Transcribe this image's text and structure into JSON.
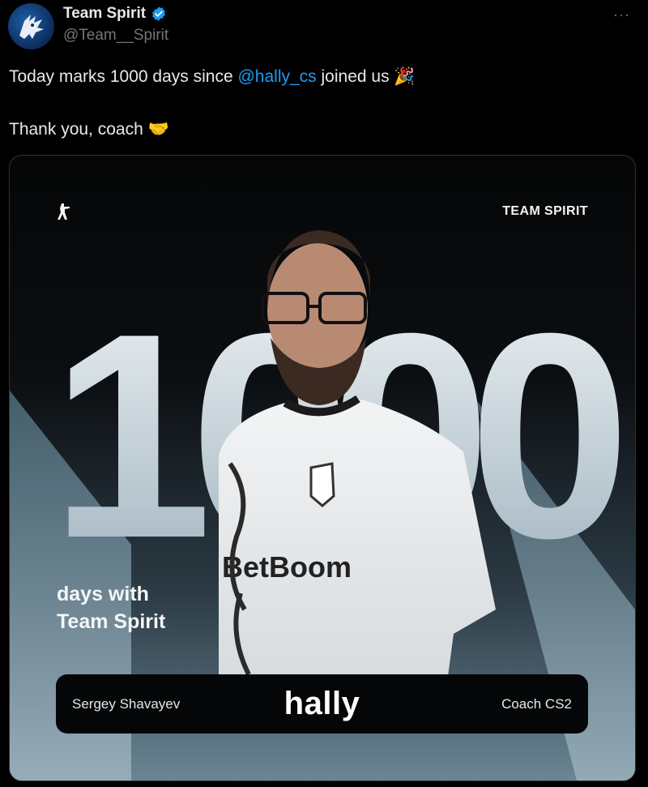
{
  "post": {
    "display_name": "Team Spirit",
    "handle": "@Team__Spirit",
    "more_label": "···",
    "text_line1_before": "Today marks 1000 days since ",
    "mention": "@hally_cs",
    "text_line1_after": " joined us 🎉",
    "text_line2": "Thank you, coach 🤝"
  },
  "image": {
    "brand": "TEAM SPIRIT",
    "big_number": "1000",
    "days_line1": "days with",
    "days_line2": "Team Spirit",
    "real_name": "Sergey Shavayev",
    "nickname": "hally",
    "role": "Coach CS2",
    "jersey_sponsor": "BetBoom"
  },
  "colors": {
    "background": "#000000",
    "link": "#1d9bf0",
    "verified": "#1d9bf0",
    "text": "#e7e9ea",
    "muted": "#71767b"
  },
  "icons": [
    "team-spirit-logo-icon",
    "verified-badge-icon",
    "more-options-icon",
    "counter-strike-icon"
  ]
}
